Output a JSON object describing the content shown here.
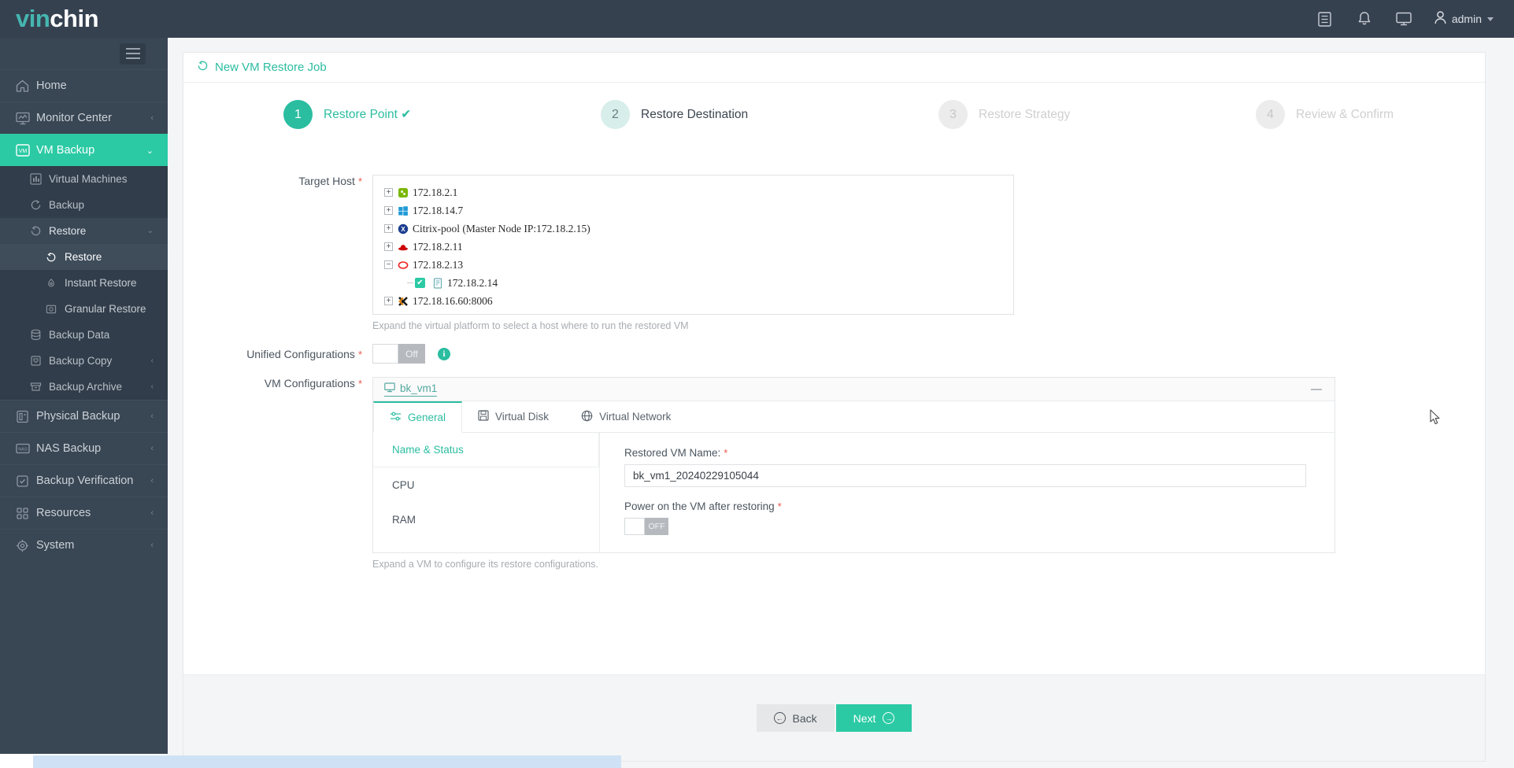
{
  "brand": {
    "part1": "vin",
    "part2": "chin"
  },
  "topbar": {
    "icons": [
      {
        "name": "logs-icon",
        "glyph": "☰"
      },
      {
        "name": "bell-icon",
        "glyph": "🔔"
      },
      {
        "name": "monitor-icon",
        "glyph": "🖥"
      }
    ],
    "user": "admin"
  },
  "sidebar": {
    "items": [
      {
        "label": "Home",
        "icon": "home-icon",
        "arrow": ""
      },
      {
        "label": "Monitor Center",
        "icon": "monitor-center-icon",
        "arrow": "‹"
      },
      {
        "label": "VM Backup",
        "icon": "vm-backup-icon",
        "arrow": "⌄",
        "active": true
      },
      {
        "label": "Physical Backup",
        "icon": "physical-backup-icon",
        "arrow": "‹"
      },
      {
        "label": "NAS Backup",
        "icon": "nas-backup-icon",
        "arrow": "‹"
      },
      {
        "label": "Backup Verification",
        "icon": "backup-verification-icon",
        "arrow": "‹"
      },
      {
        "label": "Resources",
        "icon": "resources-icon",
        "arrow": "‹"
      },
      {
        "label": "System",
        "icon": "system-icon",
        "arrow": "‹"
      }
    ],
    "vm_backup_children": [
      {
        "label": "Virtual Machines",
        "icon": "virtual-machines-icon",
        "arrow": ""
      },
      {
        "label": "Backup",
        "icon": "backup-icon",
        "arrow": ""
      },
      {
        "label": "Restore",
        "icon": "restore-icon",
        "arrow": "⌄",
        "selected": true
      },
      {
        "label": "Backup Data",
        "icon": "backup-data-icon",
        "arrow": ""
      },
      {
        "label": "Backup Copy",
        "icon": "backup-copy-icon",
        "arrow": "‹"
      },
      {
        "label": "Backup Archive",
        "icon": "backup-archive-icon",
        "arrow": "‹"
      }
    ],
    "restore_children": [
      {
        "label": "Restore",
        "icon": "restore-icon",
        "current": true
      },
      {
        "label": "Instant Restore",
        "icon": "instant-restore-icon"
      },
      {
        "label": "Granular Restore",
        "icon": "granular-restore-icon"
      }
    ]
  },
  "page": {
    "title": "New VM Restore Job",
    "title_icon": "restore-icon"
  },
  "steps": [
    {
      "num": "1",
      "label": "Restore Point",
      "state": "done",
      "check": "✔"
    },
    {
      "num": "2",
      "label": "Restore Destination",
      "state": "curr"
    },
    {
      "num": "3",
      "label": "Restore Strategy",
      "state": "todo"
    },
    {
      "num": "4",
      "label": "Review & Confirm",
      "state": "todo"
    }
  ],
  "target_host": {
    "label": "Target Host",
    "hint": "Expand the virtual platform to select a host where to run the restored VM",
    "nodes": [
      {
        "expander": "+",
        "icon": "proxmox-green-icon",
        "label": "172.18.2.1"
      },
      {
        "expander": "+",
        "icon": "hyperv-windows-icon",
        "label": "172.18.14.7"
      },
      {
        "expander": "+",
        "icon": "citrix-icon",
        "label": "Citrix-pool (Master Node IP:172.18.2.15)"
      },
      {
        "expander": "+",
        "icon": "redhat-icon",
        "label": "172.18.2.11"
      },
      {
        "expander": "−",
        "icon": "ovirt-icon",
        "label": "172.18.2.13"
      },
      {
        "child": true,
        "checked": true,
        "icon": "server-icon",
        "label": "172.18.2.14",
        "check_glyph": "✔"
      },
      {
        "expander": "+",
        "icon": "proxmox-x-icon",
        "label": "172.18.16.60:8006"
      }
    ]
  },
  "unified_config": {
    "label": "Unified Configurations",
    "toggle_state": "Off",
    "info_glyph": "i"
  },
  "vm_configurations": {
    "label": "VM Configurations",
    "hint": "Expand a VM to configure its restore configurations.",
    "vm_name": "bk_vm1",
    "tabs": [
      {
        "label": "General",
        "icon": "sliders-icon",
        "active": true
      },
      {
        "label": "Virtual Disk",
        "icon": "floppy-disk-icon"
      },
      {
        "label": "Virtual Network",
        "icon": "globe-icon"
      }
    ],
    "sub_nav": [
      {
        "label": "Name & Status",
        "active": true
      },
      {
        "label": "CPU"
      },
      {
        "label": "RAM"
      }
    ],
    "restored_name_label": "Restored VM Name:",
    "restored_name_value": "bk_vm1_20240229105044",
    "power_on_label": "Power on the VM after restoring",
    "power_on_state": "OFF"
  },
  "footer": {
    "back": "Back",
    "back_glyph": "←",
    "next": "Next",
    "next_glyph": "→"
  },
  "colors": {
    "accent": "#2bcaa4",
    "accent_dark": "#2bbda0",
    "sidebar": "#394653",
    "topbar": "#364150",
    "required": "#e8564a"
  }
}
